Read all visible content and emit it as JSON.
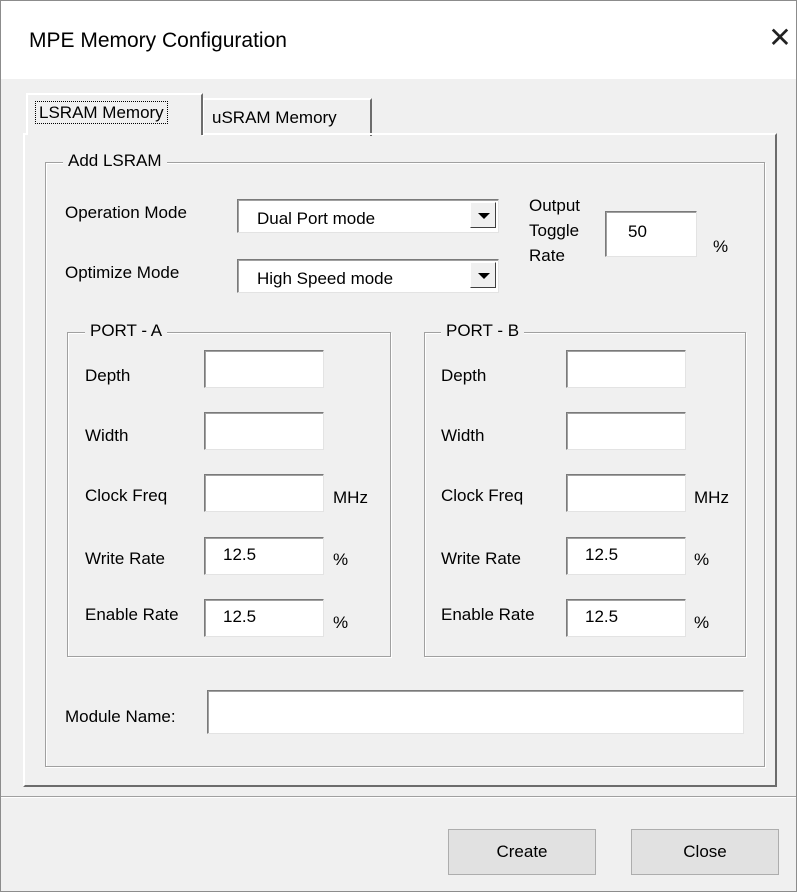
{
  "window": {
    "title": "MPE Memory Configuration",
    "close_glyph": "✕"
  },
  "tabs": [
    {
      "label": "LSRAM Memory",
      "active": true
    },
    {
      "label": "uSRAM Memory",
      "active": false
    }
  ],
  "add_lsram": {
    "group_title": "Add LSRAM",
    "operation_mode": {
      "label": "Operation Mode",
      "value": "Dual Port mode"
    },
    "optimize_mode": {
      "label": "Optimize Mode",
      "value": "High Speed mode"
    },
    "output_toggle": {
      "label_line1": "Output",
      "label_line2": "Toggle",
      "label_line3": "Rate",
      "value": "50",
      "unit": "%"
    },
    "port_a": {
      "title": "PORT - A",
      "depth_label": "Depth",
      "depth_value": "",
      "width_label": "Width",
      "width_value": "",
      "clock_label": "Clock Freq",
      "clock_value": "",
      "clock_unit": "MHz",
      "write_label": "Write Rate",
      "write_value": "12.5",
      "write_unit": "%",
      "enable_label": "Enable Rate",
      "enable_value": "12.5",
      "enable_unit": "%"
    },
    "port_b": {
      "title": "PORT - B",
      "depth_label": "Depth",
      "depth_value": "",
      "width_label": "Width",
      "width_value": "",
      "clock_label": "Clock Freq",
      "clock_value": "",
      "clock_unit": "MHz",
      "write_label": "Write Rate",
      "write_value": "12.5",
      "write_unit": "%",
      "enable_label": "Enable Rate",
      "enable_value": "12.5",
      "enable_unit": "%"
    },
    "module_name": {
      "label": "Module Name:",
      "value": ""
    }
  },
  "buttons": {
    "create": "Create",
    "close": "Close"
  },
  "icons": {
    "close": "close-icon",
    "dropdown": "chevron-down-icon"
  }
}
